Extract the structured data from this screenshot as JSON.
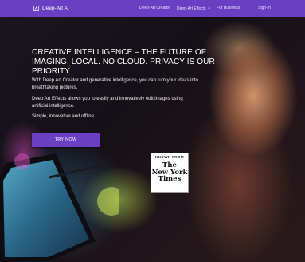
{
  "nav": {
    "brand": "Deep-Art AI",
    "items": [
      {
        "label": "Deep-Art Creator"
      },
      {
        "label": "Deep-Art Effects"
      },
      {
        "label": "For Business"
      },
      {
        "label": "Sign-In"
      }
    ]
  },
  "hero": {
    "headline": "CREATIVE INTELLIGENCE – THE FUTURE OF IMAGING. LOCAL. NO CLOUD. PRIVACY IS OUR PRIORITY",
    "paragraphs": [
      "With Deep Art Creator and generative intelligence, you can turn your ideas into breathtaking pictures.",
      "Deep Art Effects allows you to easily and innovatively edit images using artificial intelligence.",
      "Simple, innovative and offline."
    ],
    "cta_label": "TRY NOW"
  },
  "badge": {
    "label": "KNOWN FROM",
    "logo_lines": [
      "The",
      "New York",
      "Times"
    ]
  },
  "colors": {
    "brand_purple": "#6a3fc4"
  }
}
